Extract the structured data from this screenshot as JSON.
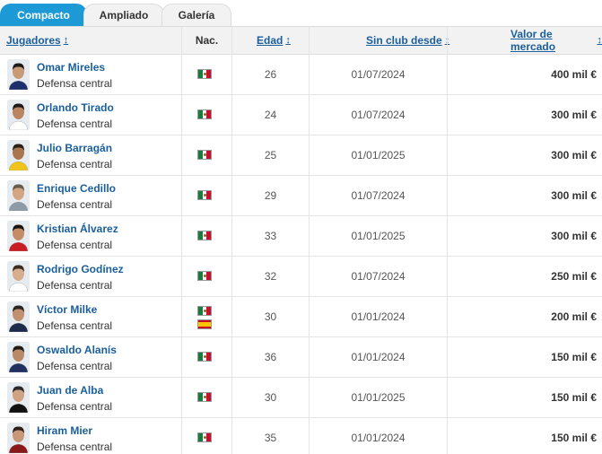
{
  "tabs": [
    {
      "label": "Compacto",
      "active": true
    },
    {
      "label": "Ampliado",
      "active": false
    },
    {
      "label": "Galería",
      "active": false
    }
  ],
  "columns": {
    "jugadores": "Jugadores",
    "nacionalidad": "Nac.",
    "edad": "Edad",
    "sin_club_desde": "Sin club desde",
    "valor": "Valor de mercado"
  },
  "colors": {
    "accent": "#1d9ad6",
    "link": "#1a5f9c",
    "header_bg": "#f2f2f2"
  },
  "players": [
    {
      "name": "Omar Mireles",
      "position": "Defensa central",
      "nationality": [
        "mexico"
      ],
      "age": "26",
      "free_since": "01/07/2024",
      "value": "400 mil €"
    },
    {
      "name": "Orlando Tirado",
      "position": "Defensa central",
      "nationality": [
        "mexico"
      ],
      "age": "24",
      "free_since": "01/07/2024",
      "value": "300 mil €"
    },
    {
      "name": "Julio Barragán",
      "position": "Defensa central",
      "nationality": [
        "mexico"
      ],
      "age": "25",
      "free_since": "01/01/2025",
      "value": "300 mil €"
    },
    {
      "name": "Enrique Cedillo",
      "position": "Defensa central",
      "nationality": [
        "mexico"
      ],
      "age": "29",
      "free_since": "01/07/2024",
      "value": "300 mil €"
    },
    {
      "name": "Kristian Álvarez",
      "position": "Defensa central",
      "nationality": [
        "mexico"
      ],
      "age": "33",
      "free_since": "01/01/2025",
      "value": "300 mil €"
    },
    {
      "name": "Rodrigo Godínez",
      "position": "Defensa central",
      "nationality": [
        "mexico"
      ],
      "age": "32",
      "free_since": "01/07/2024",
      "value": "250 mil €"
    },
    {
      "name": "Víctor Milke",
      "position": "Defensa central",
      "nationality": [
        "mexico",
        "spain"
      ],
      "age": "30",
      "free_since": "01/01/2024",
      "value": "200 mil €"
    },
    {
      "name": "Oswaldo Alanís",
      "position": "Defensa central",
      "nationality": [
        "mexico"
      ],
      "age": "36",
      "free_since": "01/01/2024",
      "value": "150 mil €"
    },
    {
      "name": "Juan de Alba",
      "position": "Defensa central",
      "nationality": [
        "mexico"
      ],
      "age": "30",
      "free_since": "01/01/2025",
      "value": "150 mil €"
    },
    {
      "name": "Hiram Mier",
      "position": "Defensa central",
      "nationality": [
        "mexico"
      ],
      "age": "35",
      "free_since": "01/01/2024",
      "value": "150 mil €"
    }
  ]
}
